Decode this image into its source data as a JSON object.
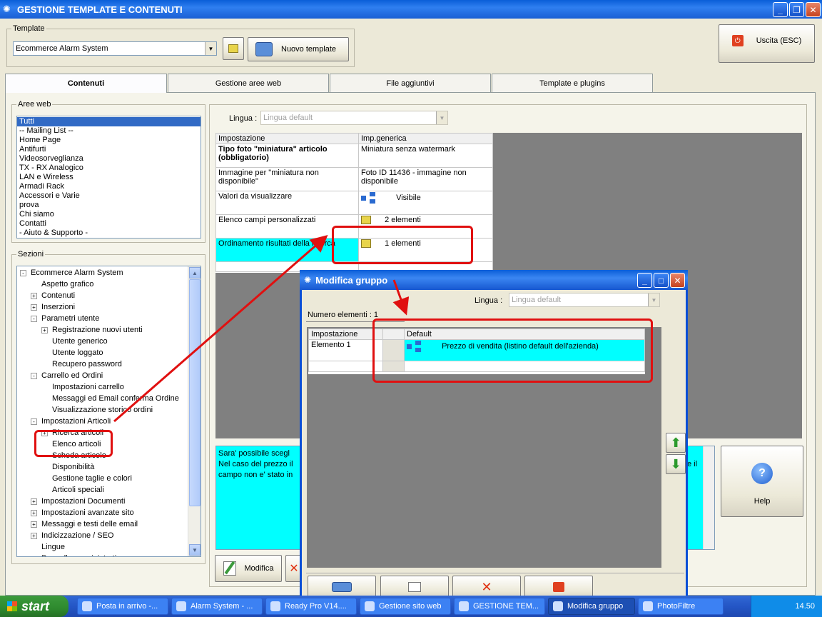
{
  "window": {
    "title": "GESTIONE TEMPLATE E CONTENUTI"
  },
  "template": {
    "legend": "Template",
    "selected": "Ecommerce Alarm System",
    "new_button": "Nuovo template"
  },
  "exit_button": "Uscita (ESC)",
  "tabs": [
    {
      "label": "Contenuti"
    },
    {
      "label": "Gestione aree web"
    },
    {
      "label": "File aggiuntivi"
    },
    {
      "label": "Template e plugins"
    }
  ],
  "aree_web": {
    "legend": "Aree web",
    "items": [
      "Tutti",
      "-- Mailing List --",
      "Home Page",
      "Antifurti",
      "Videosorveglianza",
      "TX - RX Analogico",
      "LAN e Wireless",
      "Armadi Rack",
      "Accessori e Varie",
      "prova",
      "Chi siamo",
      "Contatti",
      "- Aiuto & Supporto -"
    ]
  },
  "sezioni": {
    "legend": "Sezioni",
    "tree": [
      {
        "label": "Ecommerce Alarm System",
        "level": 0,
        "exp": "-"
      },
      {
        "label": "Aspetto grafico",
        "level": 1,
        "exp": ""
      },
      {
        "label": "Contenuti",
        "level": 1,
        "exp": "+"
      },
      {
        "label": "Inserzioni",
        "level": 1,
        "exp": "+"
      },
      {
        "label": "Parametri utente",
        "level": 1,
        "exp": "-"
      },
      {
        "label": "Registrazione nuovi utenti",
        "level": 2,
        "exp": "+"
      },
      {
        "label": "Utente generico",
        "level": 2,
        "exp": ""
      },
      {
        "label": "Utente loggato",
        "level": 2,
        "exp": ""
      },
      {
        "label": "Recupero password",
        "level": 2,
        "exp": ""
      },
      {
        "label": "Carrello ed Ordini",
        "level": 1,
        "exp": "-"
      },
      {
        "label": "Impostazioni carrello",
        "level": 2,
        "exp": ""
      },
      {
        "label": "Messaggi ed Email conferma Ordine",
        "level": 2,
        "exp": ""
      },
      {
        "label": "Visualizzazione storico ordini",
        "level": 2,
        "exp": ""
      },
      {
        "label": "Impostazioni Articoli",
        "level": 1,
        "exp": "-"
      },
      {
        "label": "Ricerca articoli",
        "level": 2,
        "exp": "+"
      },
      {
        "label": "Elenco articoli",
        "level": 2,
        "exp": ""
      },
      {
        "label": "Scheda articolo",
        "level": 2,
        "exp": ""
      },
      {
        "label": "Disponibilità",
        "level": 2,
        "exp": ""
      },
      {
        "label": "Gestione taglie e colori",
        "level": 2,
        "exp": ""
      },
      {
        "label": "Articoli speciali",
        "level": 2,
        "exp": ""
      },
      {
        "label": "Impostazioni Documenti",
        "level": 1,
        "exp": "+"
      },
      {
        "label": "Impostazioni avanzate sito",
        "level": 1,
        "exp": "+"
      },
      {
        "label": "Messaggi e testi delle email",
        "level": 1,
        "exp": "+"
      },
      {
        "label": "Indicizzazione / SEO",
        "level": 1,
        "exp": "+"
      },
      {
        "label": "Lingue",
        "level": 1,
        "exp": ""
      },
      {
        "label": "Pannello amministrativo",
        "level": 1,
        "exp": ""
      }
    ]
  },
  "lingua": {
    "label": "Lingua :",
    "value": "Lingua default"
  },
  "settings_grid": {
    "headers": [
      "Impostazione",
      "Imp.generica"
    ],
    "rows": [
      {
        "name": "Tipo foto \"miniatura\" articolo (obbligatorio)",
        "value": "Miniatura senza watermark",
        "icon": ""
      },
      {
        "name": "Immagine per \"miniatura non disponibile\"",
        "value": "Foto ID 11436 - immagine non disponibile",
        "icon": ""
      },
      {
        "name": "Valori da visualizzare",
        "value": "Visibile",
        "icon": "tree-icon"
      },
      {
        "name": "Elenco campi personalizzati",
        "value": "2 elementi",
        "icon": "folder-icon"
      },
      {
        "name": "Ordinamento risultati della ricerca",
        "value": "1 elementi",
        "icon": "folder-icon"
      }
    ]
  },
  "description": {
    "line1": "Sara' possibile scegl",
    "line2": "Nel caso del prezzo il",
    "line3": "campo non e' stato in",
    "right": "e il"
  },
  "help_button": "Help",
  "modify_button": "Modifica",
  "dialog": {
    "title": "Modifica gruppo",
    "lingua_label": "Lingua :",
    "lingua_value": "Lingua default",
    "count_label": "Numero elementi : 1",
    "headers": [
      "Impostazione",
      "",
      "Default"
    ],
    "rows": [
      {
        "name": "Elemento 1",
        "value": "Prezzo di vendita (listino default dell'azienda)"
      }
    ]
  },
  "taskbar": {
    "start": "start",
    "tasks": [
      "Posta in arrivo -...",
      "Alarm System - ...",
      "Ready Pro V14....",
      "Gestione sito web",
      "GESTIONE TEM...",
      "Modifica gruppo",
      "PhotoFiltre"
    ],
    "clock": "14.50"
  },
  "colors": {
    "highlight": "#00ffff",
    "annotation": "#e01010",
    "titlebar": "#0a5ed8"
  }
}
